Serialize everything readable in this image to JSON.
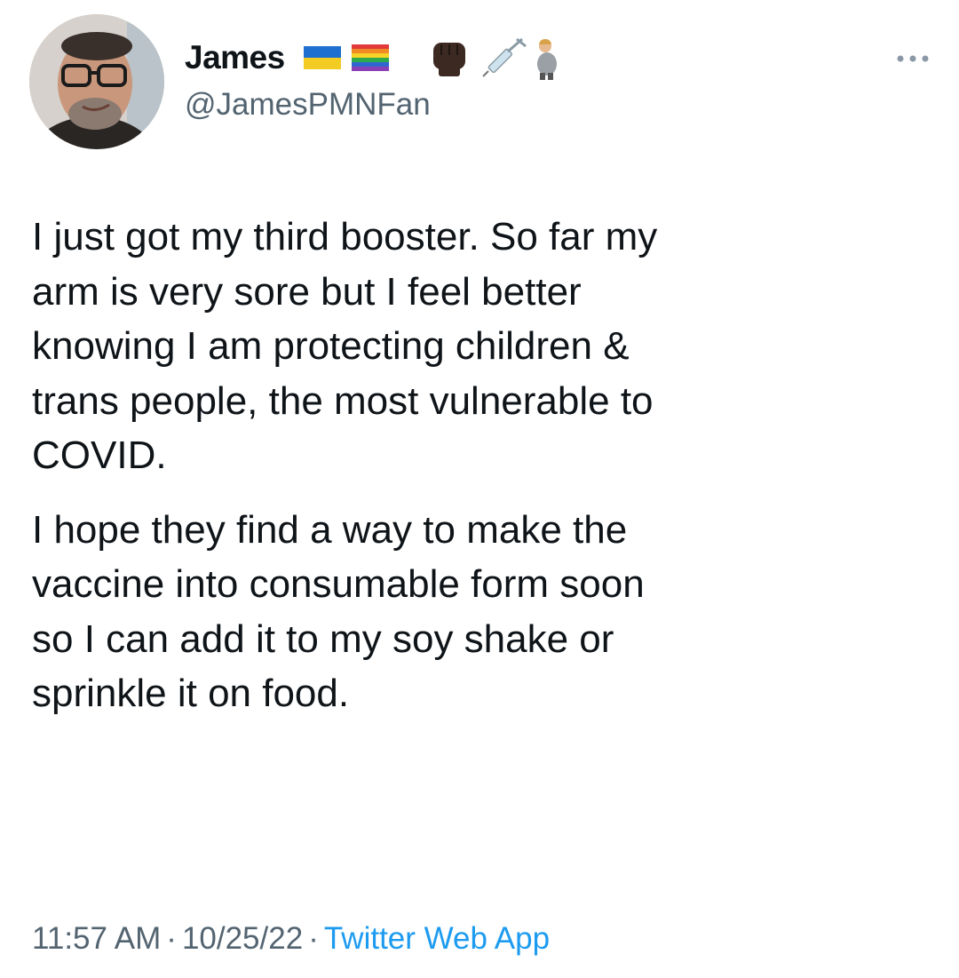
{
  "author": {
    "display_name": "James",
    "handle": "@JamesPMNFan",
    "badge_icons": [
      "ukraine-flag-icon",
      "rainbow-flag-icon",
      "raised-fist-icon",
      "syringe-icon",
      "pregnant-man-icon"
    ]
  },
  "tweet": {
    "paragraphs": [
      "I just got my third booster. So far my\narm is very sore but I feel better\nknowing I am protecting children &\ntrans people, the most vulnerable to\nCOVID.",
      "I hope they find a way to make the\nvaccine into consumable form soon\nso I can add it to my soy shake or\nsprinkle it on food."
    ]
  },
  "meta": {
    "time": "11:57 AM",
    "date": "10/25/22",
    "separator": "·",
    "source": "Twitter Web App"
  },
  "colors": {
    "text": "#0f1419",
    "secondary": "#536471",
    "link": "#1d9bf0"
  }
}
